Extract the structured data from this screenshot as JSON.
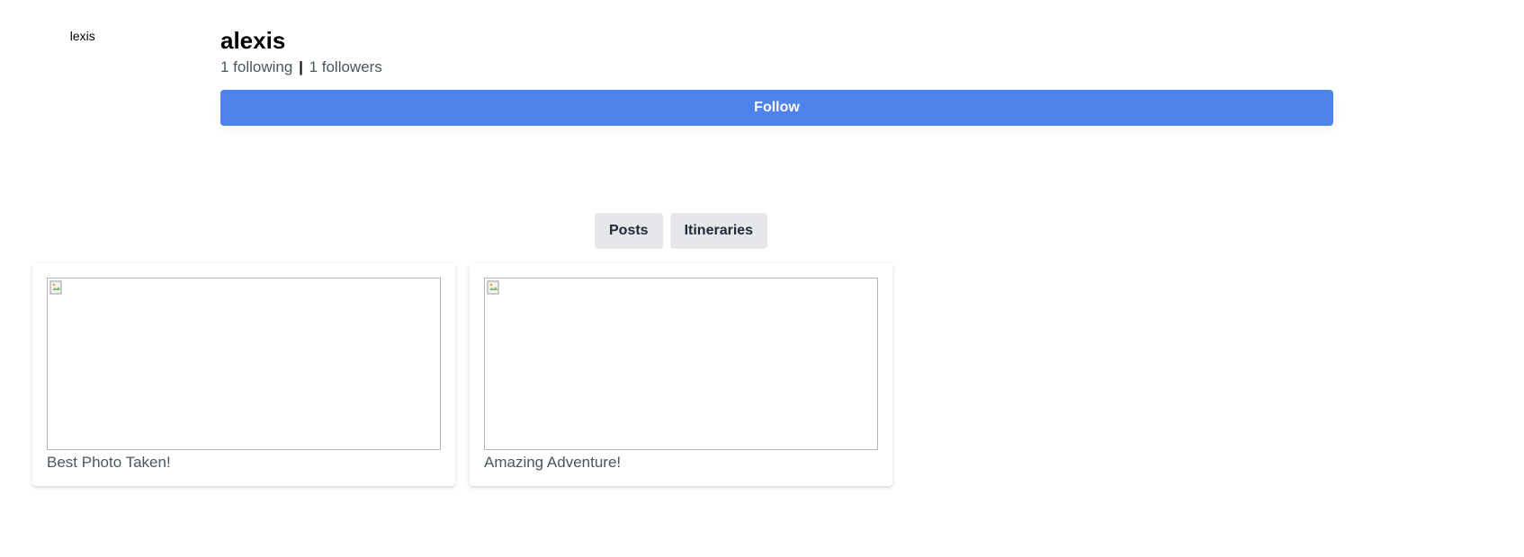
{
  "profile": {
    "avatar_alt": "alexis",
    "username": "alexis",
    "following_text": "1 following",
    "separator": "|",
    "followers_text": "1 followers",
    "follow_label": "Follow",
    "accent_color": "#4f83ec"
  },
  "tabs": [
    {
      "label": "Posts"
    },
    {
      "label": "Itineraries"
    }
  ],
  "posts": [
    {
      "caption": "Best Photo Taken!",
      "image": "broken-image-icon"
    },
    {
      "caption": "Amazing Adventure!",
      "image": "broken-image-icon"
    }
  ]
}
